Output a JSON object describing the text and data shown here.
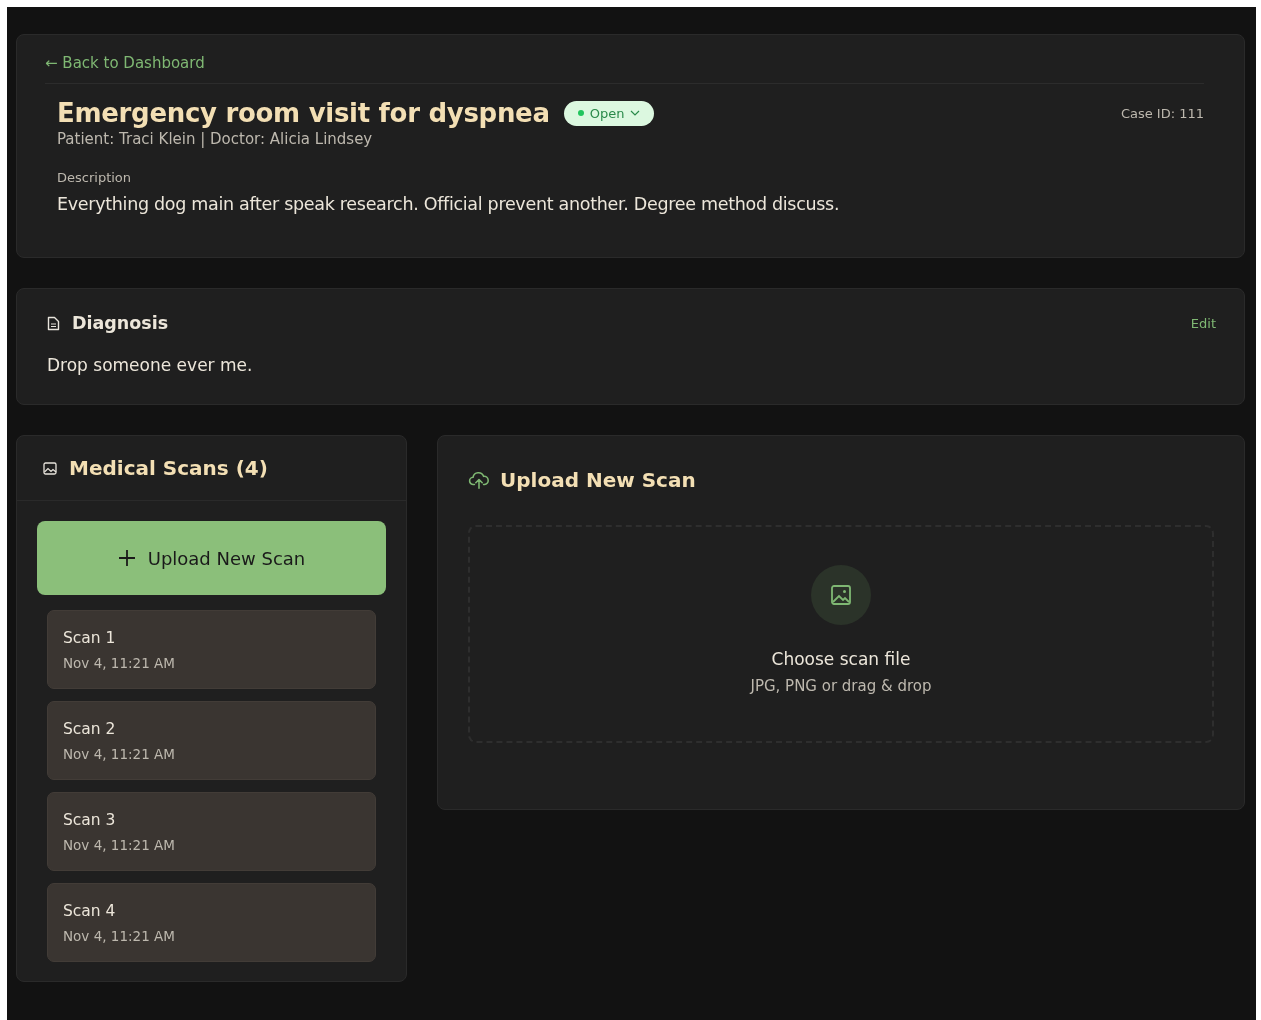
{
  "back_link": "← Back to Dashboard",
  "case": {
    "title": "Emergency room visit for dyspnea",
    "status": "Open",
    "meta": "Patient: Traci Klein | Doctor: Alicia Lindsey",
    "case_id": "Case ID: 111",
    "description_label": "Description",
    "description": "Everything dog main after speak research. Official prevent another. Degree method discuss."
  },
  "diagnosis": {
    "title": "Diagnosis",
    "edit": "Edit",
    "text": "Drop someone ever me."
  },
  "scans": {
    "title": "Medical Scans (4)",
    "upload_button": "Upload New Scan",
    "items": [
      {
        "name": "Scan 1",
        "date": "Nov 4, 11:21 AM"
      },
      {
        "name": "Scan 2",
        "date": "Nov 4, 11:21 AM"
      },
      {
        "name": "Scan 3",
        "date": "Nov 4, 11:21 AM"
      },
      {
        "name": "Scan 4",
        "date": "Nov 4, 11:21 AM"
      }
    ]
  },
  "upload": {
    "title": "Upload New Scan",
    "choose": "Choose scan file",
    "hint": "JPG, PNG or drag & drop"
  }
}
